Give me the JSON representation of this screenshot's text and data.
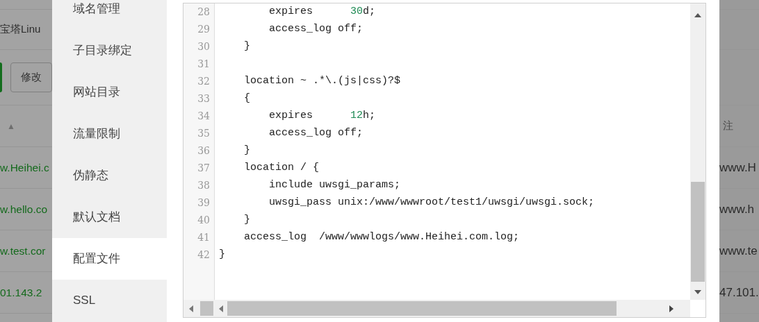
{
  "background_page": {
    "title": "宝塔Linu",
    "edit_button": "修改",
    "sort_indicator": "▲",
    "remark_header": "注",
    "rows": [
      {
        "domain": "w.Heihei.c",
        "remark": "www.H"
      },
      {
        "domain": "w.hello.co",
        "remark": "www.h"
      },
      {
        "domain": "w.test.cor",
        "remark": "www.te"
      },
      {
        "domain": "01.143.2",
        "remark": "47.101."
      }
    ]
  },
  "sidebar": {
    "items": [
      {
        "label": "域名管理",
        "selected": false
      },
      {
        "label": "子目录绑定",
        "selected": false
      },
      {
        "label": "网站目录",
        "selected": false
      },
      {
        "label": "流量限制",
        "selected": false
      },
      {
        "label": "伪静态",
        "selected": false
      },
      {
        "label": "默认文档",
        "selected": false
      },
      {
        "label": "配置文件",
        "selected": true
      },
      {
        "label": "SSL",
        "selected": false
      }
    ]
  },
  "editor": {
    "lines": [
      {
        "number": "28",
        "tokens": [
          {
            "text": "        expires      ",
            "kind": "plain"
          },
          {
            "text": "30",
            "kind": "number"
          },
          {
            "text": "d;",
            "kind": "plain"
          }
        ]
      },
      {
        "number": "29",
        "tokens": [
          {
            "text": "        access_log off;",
            "kind": "plain"
          }
        ]
      },
      {
        "number": "30",
        "tokens": [
          {
            "text": "    }",
            "kind": "plain"
          }
        ]
      },
      {
        "number": "31"
      },
      {
        "number": "32",
        "tokens": [
          {
            "text": "    location ~ .*\\.(js|css)?$",
            "kind": "plain"
          }
        ]
      },
      {
        "number": "33",
        "tokens": [
          {
            "text": "    {",
            "kind": "plain"
          }
        ]
      },
      {
        "number": "34",
        "tokens": [
          {
            "text": "        expires      ",
            "kind": "plain"
          },
          {
            "text": "12",
            "kind": "number"
          },
          {
            "text": "h;",
            "kind": "plain"
          }
        ]
      },
      {
        "number": "35",
        "tokens": [
          {
            "text": "        access_log off;",
            "kind": "plain"
          }
        ]
      },
      {
        "number": "36",
        "tokens": [
          {
            "text": "    }",
            "kind": "plain"
          }
        ]
      },
      {
        "number": "37",
        "tokens": [
          {
            "text": "    location / {",
            "kind": "plain"
          }
        ]
      },
      {
        "number": "38",
        "tokens": [
          {
            "text": "        include uwsgi_params;",
            "kind": "plain"
          }
        ]
      },
      {
        "number": "39",
        "tokens": [
          {
            "text": "        uwsgi_pass unix:/www/wwwroot/test1/uwsgi/uwsgi.sock;",
            "kind": "plain"
          }
        ]
      },
      {
        "number": "40",
        "tokens": [
          {
            "text": "    }",
            "kind": "plain"
          }
        ]
      },
      {
        "number": "41",
        "tokens": [
          {
            "text": "    access_log  /www/wwwlogs/www.Heihei.com.log;",
            "kind": "plain"
          }
        ]
      },
      {
        "number": "42",
        "tokens": [
          {
            "text": "}",
            "kind": "plain"
          }
        ]
      }
    ]
  }
}
